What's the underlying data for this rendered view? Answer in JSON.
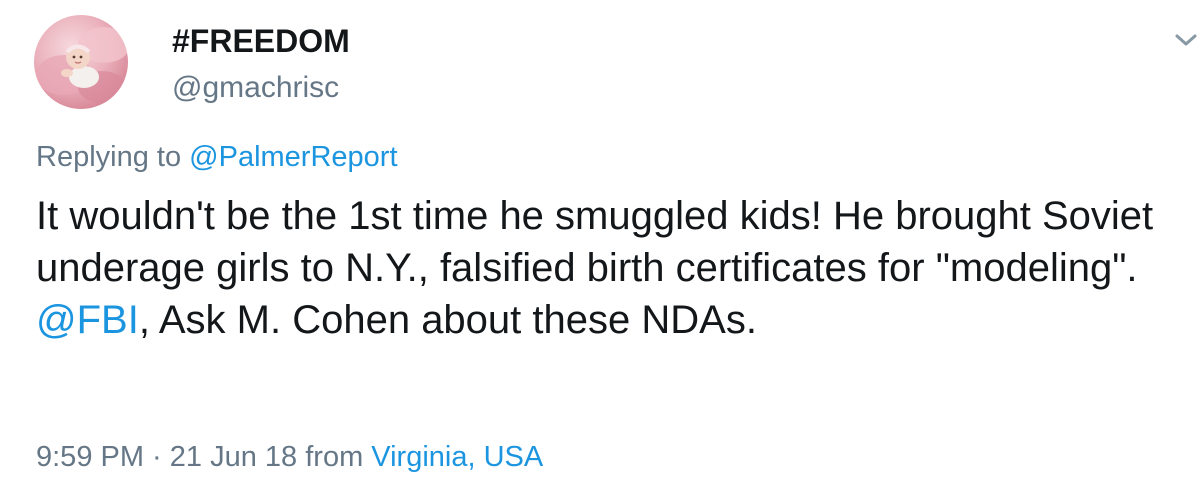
{
  "user": {
    "display_name": "#FREEDOM",
    "handle": "@gmachrisc",
    "avatar_icon": "baby-on-pink-blanket-avatar"
  },
  "menu": {
    "icon": "chevron-down-icon"
  },
  "reply": {
    "prefix": "Replying to ",
    "mention": "@PalmerReport"
  },
  "tweet": {
    "text_part1": "It wouldn't be the 1st time he smuggled kids! He brought Soviet underage girls to N.Y., falsified birth certificates for \"modeling\". ",
    "mention": "@FBI",
    "text_part2": ", Ask M. Cohen about these NDAs."
  },
  "meta": {
    "time": "9:59 PM",
    "separator": " · ",
    "date": "21 Jun 18",
    "from_label": " from ",
    "location": "Virginia, USA"
  },
  "colors": {
    "link": "#1b95e0",
    "muted": "#657786",
    "text": "#14171a"
  }
}
